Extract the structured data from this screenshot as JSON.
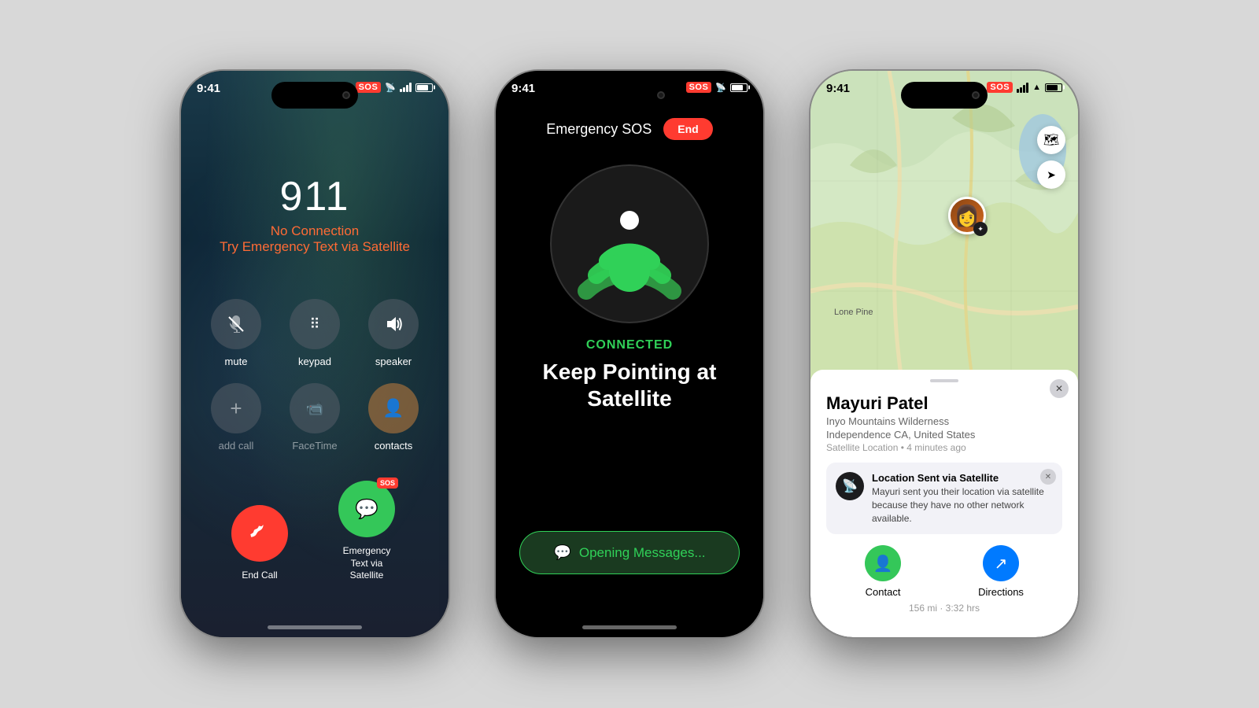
{
  "background_color": "#d0d0d0",
  "phone1": {
    "status_time": "9:41",
    "sos_label": "SOS",
    "call_number": "911",
    "no_connection": "No Connection",
    "satellite_prompt": "Try Emergency Text via Satellite",
    "buttons": [
      {
        "icon": "🎤",
        "label": "mute",
        "muted": true
      },
      {
        "icon": "⠿",
        "label": "keypad"
      },
      {
        "icon": "🔊",
        "label": "speaker"
      },
      {
        "icon": "+",
        "label": "add call"
      },
      {
        "icon": "📹",
        "label": "FaceTime"
      },
      {
        "icon": "👤",
        "label": "contacts"
      }
    ],
    "end_call_label": "End Call",
    "emergency_text_label": "Emergency Text\nvia Satellite"
  },
  "phone2": {
    "status_time": "9:41",
    "sos_label": "SOS",
    "emergency_sos_title": "Emergency SOS",
    "end_button_label": "End",
    "connected_label": "CONNECTED",
    "keep_pointing_label": "Keep Pointing at\nSatellite",
    "opening_messages_label": "Opening Messages..."
  },
  "phone3": {
    "status_time": "9:41",
    "sos_label": "SOS",
    "location_name": "Lone Pine",
    "person_name": "Mayuri Patel",
    "person_area": "Inyo Mountains Wilderness",
    "person_city": "Independence CA, United States",
    "person_location_type": "Satellite Location",
    "person_time_ago": "4 minutes ago",
    "notif_title": "Location Sent via Satellite",
    "notif_desc": "Mayuri sent you their location via satellite because they have no other network available.",
    "contact_label": "Contact",
    "directions_label": "Directions",
    "directions_distance": "156 mi · 3:32 hrs"
  }
}
